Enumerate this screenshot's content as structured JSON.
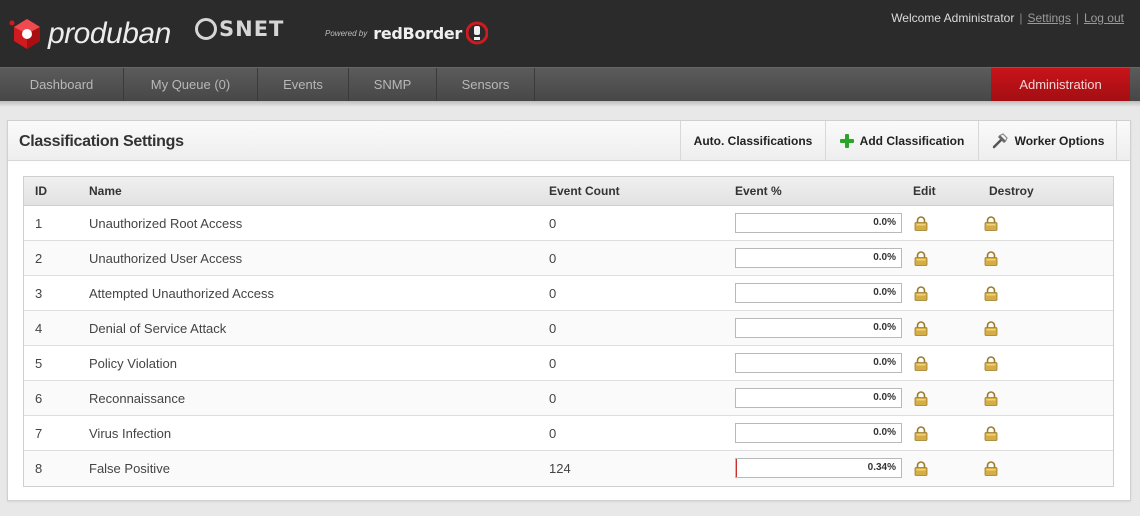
{
  "header": {
    "brand": "produban",
    "partner": "SNET",
    "powered_by": "Powered by",
    "product": "redBorder",
    "welcome": "Welcome Administrator",
    "links": [
      "Settings",
      "Log out"
    ]
  },
  "nav": {
    "items": [
      "Dashboard",
      "My Queue (0)",
      "Events",
      "SNMP",
      "Sensors"
    ],
    "admin": "Administration"
  },
  "panel": {
    "title": "Classification Settings",
    "buttons": {
      "auto": "Auto. Classifications",
      "add": "Add Classification",
      "worker": "Worker Options"
    }
  },
  "table": {
    "columns": [
      "ID",
      "Name",
      "Event Count",
      "Event %",
      "Edit",
      "Destroy"
    ],
    "rows": [
      {
        "id": "1",
        "name": "Unauthorized Root Access",
        "count": "0",
        "percent": "0.0%",
        "fill": 0
      },
      {
        "id": "2",
        "name": "Unauthorized User Access",
        "count": "0",
        "percent": "0.0%",
        "fill": 0
      },
      {
        "id": "3",
        "name": "Attempted Unauthorized Access",
        "count": "0",
        "percent": "0.0%",
        "fill": 0
      },
      {
        "id": "4",
        "name": "Denial of Service Attack",
        "count": "0",
        "percent": "0.0%",
        "fill": 0
      },
      {
        "id": "5",
        "name": "Policy Violation",
        "count": "0",
        "percent": "0.0%",
        "fill": 0
      },
      {
        "id": "6",
        "name": "Reconnaissance",
        "count": "0",
        "percent": "0.0%",
        "fill": 0
      },
      {
        "id": "7",
        "name": "Virus Infection",
        "count": "0",
        "percent": "0.0%",
        "fill": 0
      },
      {
        "id": "8",
        "name": "False Positive",
        "count": "124",
        "percent": "0.34%",
        "fill": 0.0034
      }
    ]
  },
  "icons": {
    "plus": "plus-icon",
    "wrench": "wrench-icon",
    "lock": "lock-icon"
  },
  "colors": {
    "header_bg": "#2b2b2b",
    "nav_bg": "#4f4f4f",
    "admin_bg": "#b31116",
    "plus_green": "#2aa52a",
    "lock_gold": "#c9a23c"
  }
}
